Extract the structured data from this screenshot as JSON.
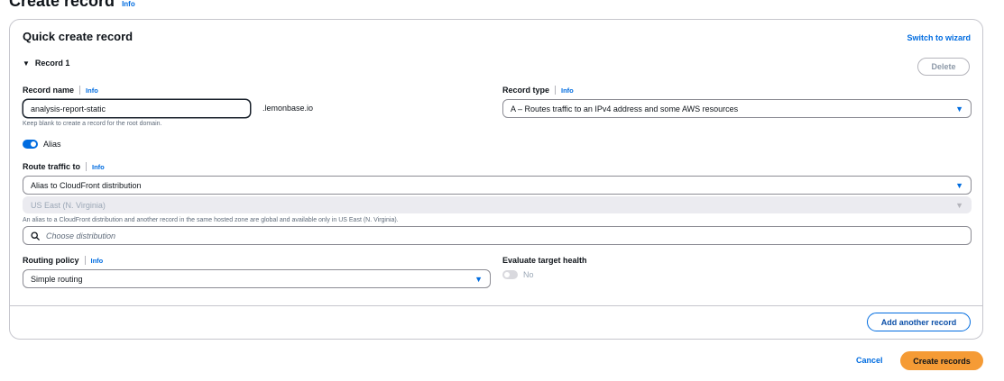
{
  "page": {
    "title": "Create record",
    "info": "Info"
  },
  "panel": {
    "title": "Quick create record",
    "switch_link": "Switch to wizard"
  },
  "record": {
    "header": "Record 1",
    "delete_label": "Delete",
    "record_name": {
      "label": "Record name",
      "info": "Info",
      "value": "analysis-report-static",
      "suffix": ".lemonbase.io",
      "hint": "Keep blank to create a record for the root domain."
    },
    "record_type": {
      "label": "Record type",
      "info": "Info",
      "value": "A – Routes traffic to an IPv4 address and some AWS resources"
    },
    "alias": {
      "label": "Alias",
      "enabled": true
    },
    "route_traffic": {
      "label": "Route traffic to",
      "info": "Info",
      "endpoint_value": "Alias to CloudFront distribution",
      "region_value": "US East (N. Virginia)",
      "hint": "An alias to a CloudFront distribution and another record in the same hosted zone are global and available only in US East (N. Virginia).",
      "search_placeholder": "Choose distribution"
    },
    "routing_policy": {
      "label": "Routing policy",
      "info": "Info",
      "value": "Simple routing"
    },
    "evaluate_health": {
      "label": "Evaluate target health",
      "toggle_label": "No",
      "enabled": false
    }
  },
  "footer": {
    "add_another": "Add another record",
    "cancel": "Cancel",
    "create": "Create records"
  },
  "colors": {
    "accent": "#006ce0",
    "primary_button": "#f59b35",
    "border": "#c6c6cd"
  },
  "icons": {
    "dropdown": "caret-down-icon",
    "expand": "caret-down-icon",
    "search": "search-icon"
  }
}
